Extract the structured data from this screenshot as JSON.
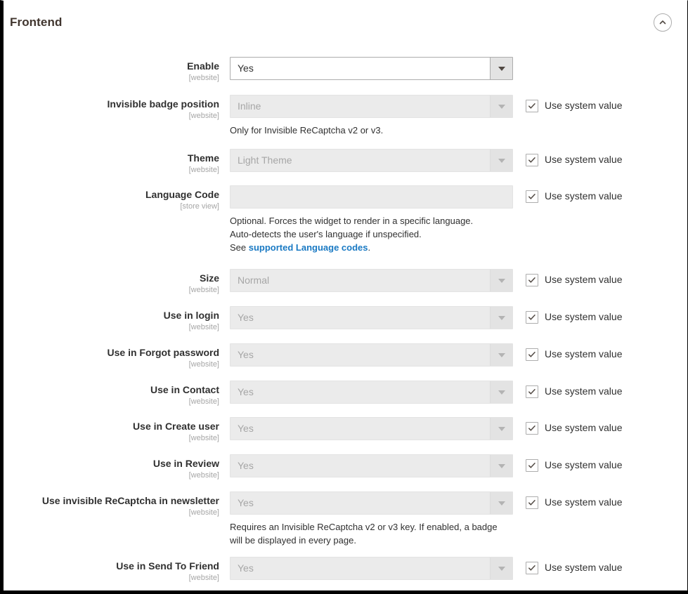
{
  "section": {
    "title": "Frontend",
    "collapse_icon": "chevron-up-icon"
  },
  "labels": {
    "use_system_value": "Use system value"
  },
  "fields": [
    {
      "label": "Enable",
      "scope": "[website]",
      "control": "select",
      "value": "Yes",
      "disabled": false,
      "system_value_checkbox": false,
      "note": null
    },
    {
      "label": "Invisible badge position",
      "scope": "[website]",
      "control": "select",
      "value": "Inline",
      "disabled": true,
      "system_value_checkbox": true,
      "note": "Only for Invisible ReCaptcha v2 or v3."
    },
    {
      "label": "Theme",
      "scope": "[website]",
      "control": "select",
      "value": "Light Theme",
      "disabled": true,
      "system_value_checkbox": true,
      "note": null
    },
    {
      "label": "Language Code",
      "scope": "[store view]",
      "control": "text",
      "value": "",
      "placeholder": "",
      "disabled": true,
      "system_value_checkbox": true,
      "note_parts": {
        "line1": "Optional. Forces the widget to render in a specific language.",
        "line2": "Auto-detects the user's language if unspecified.",
        "line3_prefix": "See ",
        "link_text": "supported Language codes",
        "line3_suffix": "."
      }
    },
    {
      "label": "Size",
      "scope": "[website]",
      "control": "select",
      "value": "Normal",
      "disabled": true,
      "system_value_checkbox": true,
      "note": null
    },
    {
      "label": "Use in login",
      "scope": "[website]",
      "control": "select",
      "value": "Yes",
      "disabled": true,
      "system_value_checkbox": true,
      "note": null
    },
    {
      "label": "Use in Forgot password",
      "scope": "[website]",
      "control": "select",
      "value": "Yes",
      "disabled": true,
      "system_value_checkbox": true,
      "note": null
    },
    {
      "label": "Use in Contact",
      "scope": "[website]",
      "control": "select",
      "value": "Yes",
      "disabled": true,
      "system_value_checkbox": true,
      "note": null
    },
    {
      "label": "Use in Create user",
      "scope": "[website]",
      "control": "select",
      "value": "Yes",
      "disabled": true,
      "system_value_checkbox": true,
      "note": null
    },
    {
      "label": "Use in Review",
      "scope": "[website]",
      "control": "select",
      "value": "Yes",
      "disabled": true,
      "system_value_checkbox": true,
      "note": null
    },
    {
      "label": "Use invisible ReCaptcha in newsletter",
      "scope": "[website]",
      "control": "select",
      "value": "Yes",
      "disabled": true,
      "system_value_checkbox": true,
      "note": "Requires an Invisible ReCaptcha v2 or v3 key. If enabled, a badge will be displayed in every page."
    },
    {
      "label": "Use in Send To Friend",
      "scope": "[website]",
      "control": "select",
      "value": "Yes",
      "disabled": true,
      "system_value_checkbox": true,
      "note": null
    }
  ],
  "colors": {
    "link": "#1979c3",
    "label_text": "#303030",
    "scope_text": "#a6a6a6",
    "title_text": "#41362f",
    "disabled_field_bg": "#ebebeb",
    "select_arrow_bg": "#e3e3e3",
    "border": "#adadad"
  }
}
